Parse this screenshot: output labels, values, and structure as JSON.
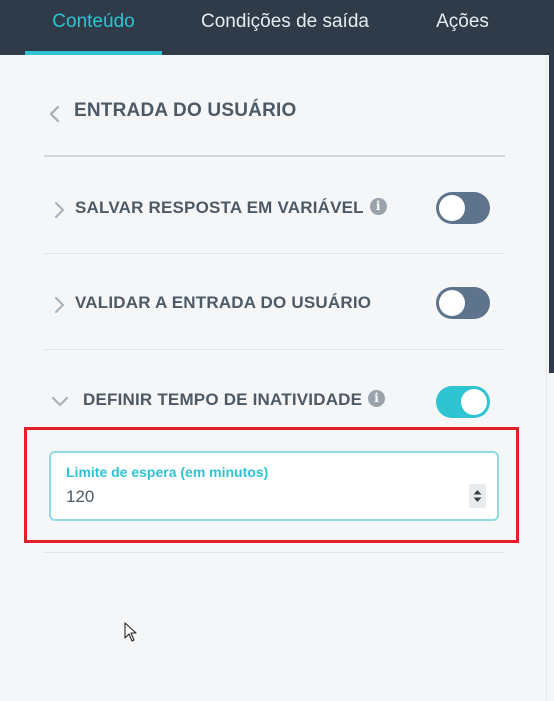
{
  "tabs": [
    {
      "label": "Conteúdo"
    },
    {
      "label": "Condições de saída"
    },
    {
      "label": "Ações"
    }
  ],
  "section": {
    "title": "ENTRADA DO USUÁRIO",
    "back_icon": "chevron-left-icon"
  },
  "rows": [
    {
      "label": "SALVAR RESPOSTA EM VARIÁVEL",
      "has_info": true,
      "expanded": false,
      "toggle_on": false
    },
    {
      "label": "VALIDAR A ENTRADA DO USUÁRIO",
      "has_info": false,
      "expanded": false,
      "toggle_on": false
    },
    {
      "label": "DEFINIR TEMPO DE INATIVIDADE",
      "has_info": true,
      "expanded": true,
      "toggle_on": true
    }
  ],
  "info_glyph": "i",
  "timeout_field": {
    "label": "Limite de espera (em minutos)",
    "value": "120"
  },
  "colors": {
    "accent": "#2ec4d2",
    "header_bg": "#2f3b48",
    "toggle_off": "#5e738c",
    "highlight": "#e0202a"
  }
}
